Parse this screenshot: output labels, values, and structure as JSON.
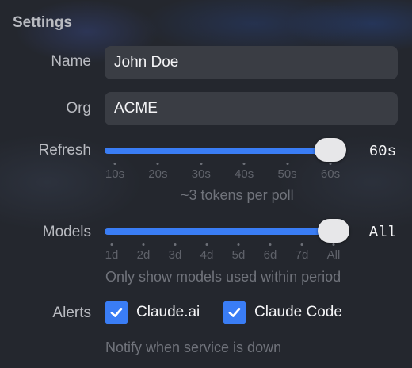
{
  "settings": {
    "title": "Settings",
    "name": {
      "label": "Name",
      "value": "John Doe"
    },
    "org": {
      "label": "Org",
      "value": "ACME"
    },
    "refresh": {
      "label": "Refresh",
      "value_text": "60s",
      "value_fraction": 1.0,
      "ticks": [
        "10s",
        "20s",
        "30s",
        "40s",
        "50s",
        "60s"
      ],
      "hint": "~3 tokens per poll"
    },
    "models": {
      "label": "Models",
      "value_text": "All",
      "value_fraction": 1.0,
      "ticks": [
        "1d",
        "2d",
        "3d",
        "4d",
        "5d",
        "6d",
        "7d",
        "All"
      ],
      "hint": "Only show models used within period"
    },
    "alerts": {
      "label": "Alerts",
      "options": [
        {
          "label": "Claude.ai",
          "checked": true
        },
        {
          "label": "Claude Code",
          "checked": true
        }
      ],
      "hint": "Notify when service is down"
    }
  },
  "colors": {
    "accent": "#3a7df5",
    "background": "#22252b",
    "field": "#3a3d44"
  }
}
